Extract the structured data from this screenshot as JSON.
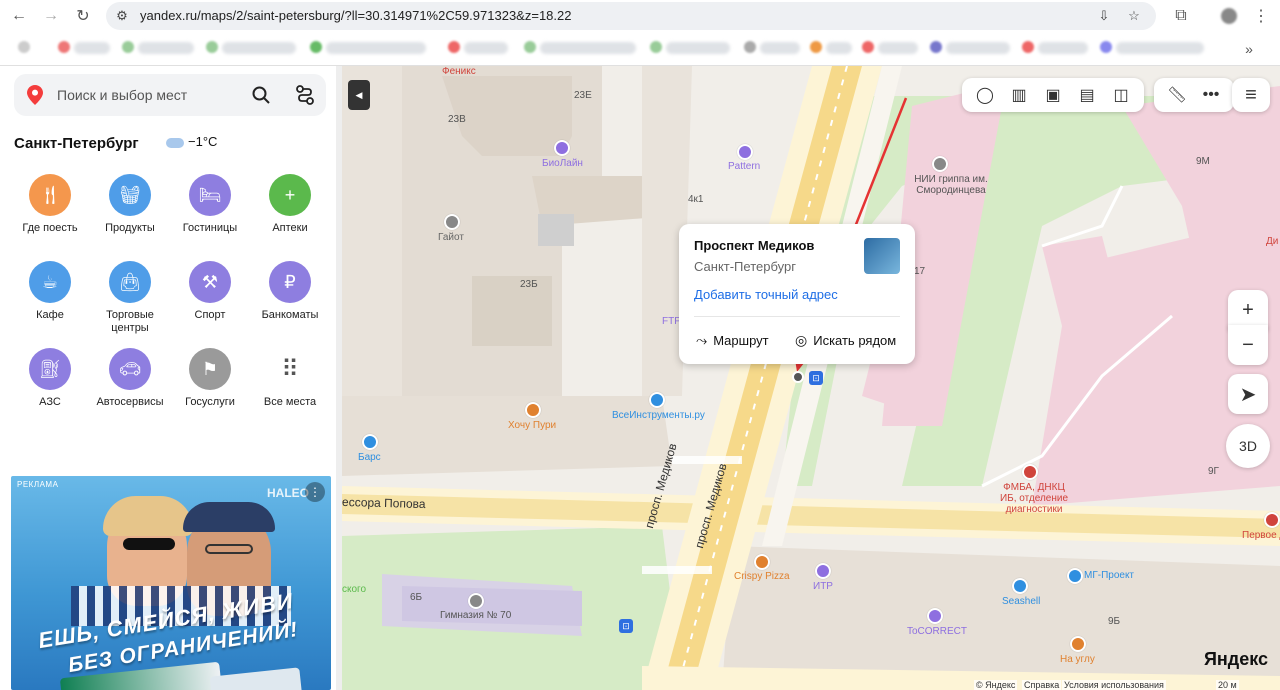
{
  "browser": {
    "url": "yandex.ru/maps/2/saint-petersburg/?ll=30.314971%2C59.971323&z=18.22"
  },
  "sidebar": {
    "search_placeholder": "Поиск и выбор мест",
    "city": "Санкт-Петербург",
    "weather": "−1°C",
    "categories": [
      {
        "label": "Где поесть",
        "icon": "fork-knife-icon",
        "color": "#f4974d"
      },
      {
        "label": "Продукты",
        "icon": "basket-icon",
        "color": "#4f9de8"
      },
      {
        "label": "Гостиницы",
        "icon": "bed-icon",
        "color": "#8e7ee0"
      },
      {
        "label": "Аптеки",
        "icon": "plus-icon",
        "color": "#5bb94c"
      },
      {
        "label": "Кафе",
        "icon": "cup-icon",
        "color": "#4f9de8"
      },
      {
        "label": "Торговые центры",
        "icon": "bag-icon",
        "color": "#4f9de8"
      },
      {
        "label": "Спорт",
        "icon": "dumbbell-icon",
        "color": "#8e7ee0"
      },
      {
        "label": "Банкоматы",
        "icon": "ruble-icon",
        "color": "#8e7ee0"
      },
      {
        "label": "АЗС",
        "icon": "fuel-icon",
        "color": "#8e7ee0"
      },
      {
        "label": "Автосервисы",
        "icon": "car-icon",
        "color": "#8e7ee0"
      },
      {
        "label": "Госуслуги",
        "icon": "flag-icon",
        "color": "#9a9a9a"
      },
      {
        "label": "Все места",
        "icon": "grid-icon",
        "color": "#ffffff"
      }
    ],
    "ad": {
      "tag": "РЕКЛАМА",
      "brand": "HALEO",
      "slogan1": "ЕШЬ, СМЕЙСЯ, ЖИВИ",
      "slogan2": "БЕЗ ОГРАНИЧЕНИЙ!"
    }
  },
  "map": {
    "buildings": [
      "23Е",
      "23В",
      "4к1",
      "23Б",
      "17",
      "9М",
      "9Г",
      "6Б",
      "9Б"
    ],
    "streets": [
      "ессора Попова",
      "просп. Медиков",
      "просп. Медиков"
    ],
    "pois": [
      {
        "label": "Феникс",
        "color": "#d0443c"
      },
      {
        "label": "БиоЛайн",
        "color": "#8e6fe0"
      },
      {
        "label": "Pattern",
        "color": "#8e6fe0"
      },
      {
        "label": "Гайот",
        "color": "#888888"
      },
      {
        "label": "НИИ гриппа им. Смородинцева",
        "color": "#888888"
      },
      {
        "label": "FTF",
        "color": "#8e6fe0"
      },
      {
        "label": "ВсеИнструменты.ру",
        "color": "#2f8fe0"
      },
      {
        "label": "Хочу Пури",
        "color": "#e0812f"
      },
      {
        "label": "Барс",
        "color": "#2f8fe0"
      },
      {
        "label": "ФМБА, ДНКЦ ИБ, отделение диагностики",
        "color": "#d0443c"
      },
      {
        "label": "Первое Д",
        "color": "#d0443c"
      },
      {
        "label": "Crispy Pizza",
        "color": "#e0812f"
      },
      {
        "label": "ИТР",
        "color": "#8e6fe0"
      },
      {
        "label": "МГ-Проект",
        "color": "#2f8fe0"
      },
      {
        "label": "Seashell",
        "color": "#2f8fe0"
      },
      {
        "label": "ToCORRECT",
        "color": "#8e6fe0"
      },
      {
        "label": "На углу",
        "color": "#e0812f"
      },
      {
        "label": "Гимназия № 70",
        "color": "#888888"
      },
      {
        "label": "Ди",
        "color": "#d0443c"
      },
      {
        "label": "ского",
        "color": "#5bb94c"
      }
    ],
    "popup": {
      "title": "Проспект Медиков",
      "subtitle": "Санкт-Петербург",
      "link": "Добавить точный адрес",
      "route_label": "Маршрут",
      "nearby_label": "Искать рядом"
    },
    "controls": {
      "zoom_in": "+",
      "zoom_out": "−",
      "three_d": "3D"
    },
    "footer": {
      "copyright": "© Яндекс",
      "help": "Справка",
      "terms": "Условия использования",
      "scale": "20 м"
    },
    "logo": "Яндекс"
  }
}
